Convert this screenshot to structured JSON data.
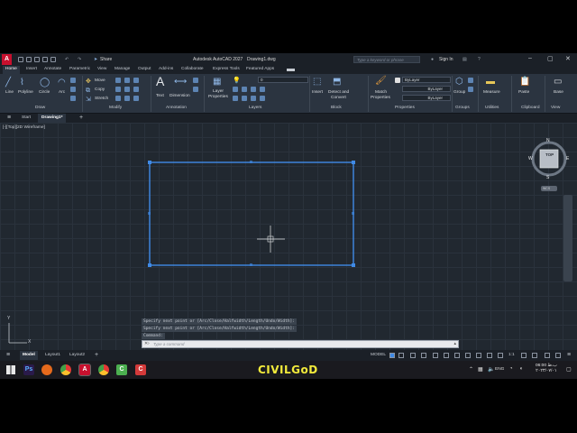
{
  "app": {
    "title": "Autodesk AutoCAD 2027",
    "file": "Drawing1.dwg",
    "logo": "A",
    "share": "Share",
    "search_placeholder": "Type a keyword or phrase",
    "sign_in": "Sign In"
  },
  "ribbon_tabs": [
    "Home",
    "Insert",
    "Annotate",
    "Parametric",
    "View",
    "Manage",
    "Output",
    "Add-ins",
    "Collaborate",
    "Express Tools",
    "Featured Apps"
  ],
  "ribbon": {
    "draw": {
      "label": "Draw",
      "tools": [
        "Line",
        "Polyline",
        "Circle",
        "Arc"
      ]
    },
    "modify": {
      "label": "Modify",
      "tools": [
        "Move",
        "Copy",
        "Stretch"
      ]
    },
    "annotation": {
      "label": "Annotation",
      "text": "Text",
      "dimension": "Dimension"
    },
    "layers": {
      "label": "Layers",
      "properties": "Layer",
      "properties2": "Properties",
      "current_layer": "0"
    },
    "block": {
      "label": "Block",
      "insert": "Insert",
      "detect": "Detect and",
      "convert": "Convert"
    },
    "properties": {
      "label": "Properties",
      "match": "Match",
      "match2": "Properties",
      "bylayer": "ByLayer"
    },
    "groups": {
      "label": "Groups",
      "group": "Group"
    },
    "utilities": {
      "label": "Utilities",
      "measure": "Measure"
    },
    "clipboard": {
      "label": "Clipboard",
      "paste": "Paste"
    },
    "view": {
      "label": "View",
      "base": "Base"
    }
  },
  "file_tabs": {
    "start": "Start",
    "drawing": "Drawing1*"
  },
  "viewport": {
    "label": "[-][Top][2D Wireframe]",
    "viewcube": {
      "top": "TOP",
      "n": "N",
      "s": "S",
      "e": "E",
      "w": "W",
      "wcs": "WCS"
    },
    "ucs": {
      "x": "X",
      "y": "Y"
    }
  },
  "command": {
    "history": [
      "Specify next point or [Arc/Close/Halfwidth/Length/Undo/Width]:",
      "Specify next point or [Arc/Close/Halfwidth/Length/Undo/Width]:",
      "Command:"
    ],
    "placeholder": "Type a command"
  },
  "status": {
    "tabs": [
      "Model",
      "Layout1",
      "Layout2"
    ],
    "model_label": "MODEL",
    "scale": "1:1"
  },
  "taskbar": {
    "lang": "ENG",
    "time": "06:00 ب.ظ",
    "date": "۲۰۲۳/۰۷/۰۱",
    "watermark": "CIVILGoD"
  },
  "colors": {
    "accent": "#3f8ae6",
    "background": "#212830",
    "watermark": "#f2ea3b"
  }
}
